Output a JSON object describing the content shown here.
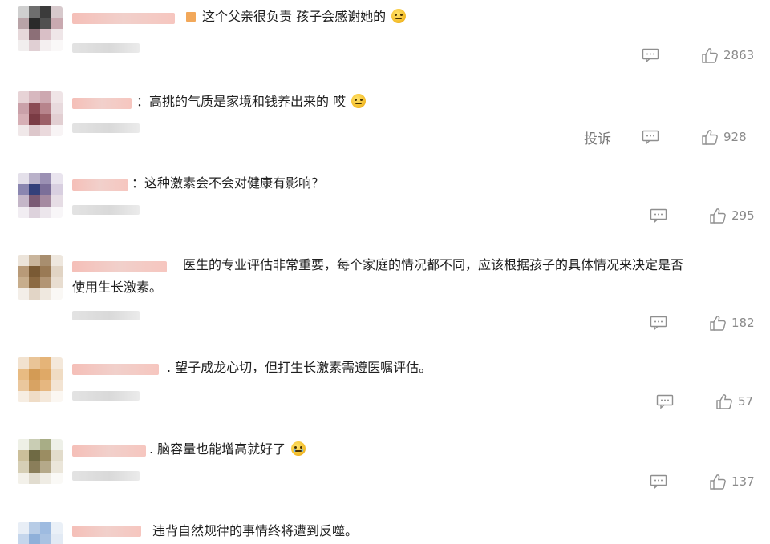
{
  "comments": [
    {
      "text": "这个父亲很负责 孩子会感谢她的",
      "emoji": "smirk-emoji",
      "likes": "2863",
      "report_label": ""
    },
    {
      "text": "：高挑的气质是家境和钱养出来的 哎",
      "emoji": "meh-emoji",
      "likes": "928",
      "report_label": "投诉"
    },
    {
      "text": "：这种激素会不会对健康有影响？",
      "emoji": "",
      "likes": "295",
      "report_label": ""
    },
    {
      "text_line1": "医生的专业评估非常重要，每个家庭的情况都不同，应该根据孩子的具体情况来决定是否",
      "text_line2": "使用生长激素。",
      "emoji": "",
      "likes": "182",
      "report_label": ""
    },
    {
      "text": ". 望子成龙心切，但打生长激素需遵医嘱评估。",
      "emoji": "",
      "likes": "57",
      "report_label": ""
    },
    {
      "text": ". 脑容量也能增高就好了",
      "emoji": "laugh-cry-emoji",
      "likes": "137",
      "report_label": ""
    },
    {
      "text": "违背自然规律的事情终将遭到反噬。",
      "emoji": "",
      "likes": "",
      "report_label": ""
    }
  ],
  "colors": {
    "text": "#1f1f1f",
    "action_gray": "#8f8f8f",
    "name_blur_pink": "#f5bfb8",
    "meta_blur_gray": "#e3e3e3"
  }
}
